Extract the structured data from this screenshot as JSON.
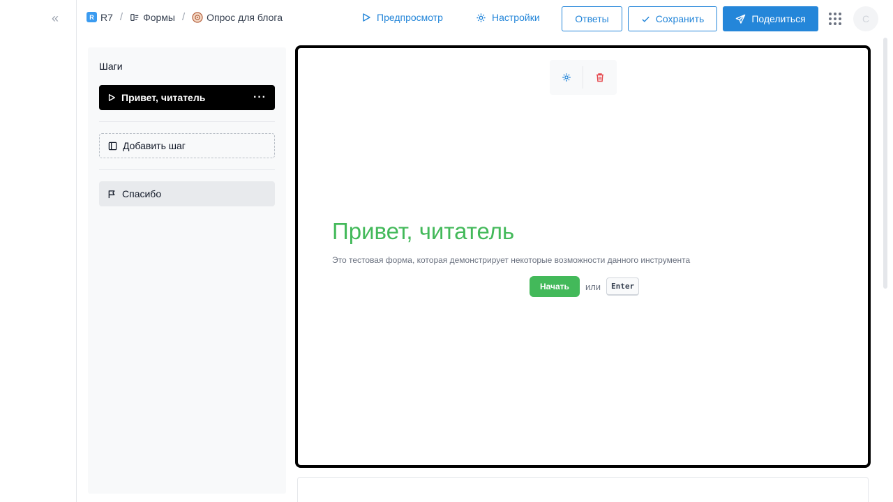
{
  "breadcrumb": {
    "workspace_badge": "R",
    "workspace": "R7",
    "section": "Формы",
    "form_name": "Опрос для блога",
    "separator": "/"
  },
  "header": {
    "preview_label": "Предпросмотр",
    "settings_label": "Настройки",
    "responses_label": "Ответы",
    "save_label": "Сохранить",
    "share_label": "Поделиться",
    "avatar_initial": "С"
  },
  "steps": {
    "title": "Шаги",
    "active_step": "Привет, читатель",
    "more_label": "···",
    "add_step_label": "Добавить шаг",
    "thanks_step": "Спасибо"
  },
  "canvas": {
    "title": "Привет, читатель",
    "description": "Это тестовая форма, которая демонстрирует некоторые возможности данного инструмента",
    "start_label": "Начать",
    "or_label": "или",
    "key_hint": "Enter"
  },
  "colors": {
    "accent": "#2486d9",
    "success": "#43b95a",
    "danger": "#e5484d"
  },
  "icons": {
    "collapse": "double-chevron-left-icon",
    "preview": "play-icon",
    "settings": "gear-icon",
    "save": "check-icon",
    "share": "send-icon",
    "apps": "grid-icon",
    "delete": "trash-icon",
    "add_step": "layout-icon",
    "thanks": "flag-icon"
  }
}
